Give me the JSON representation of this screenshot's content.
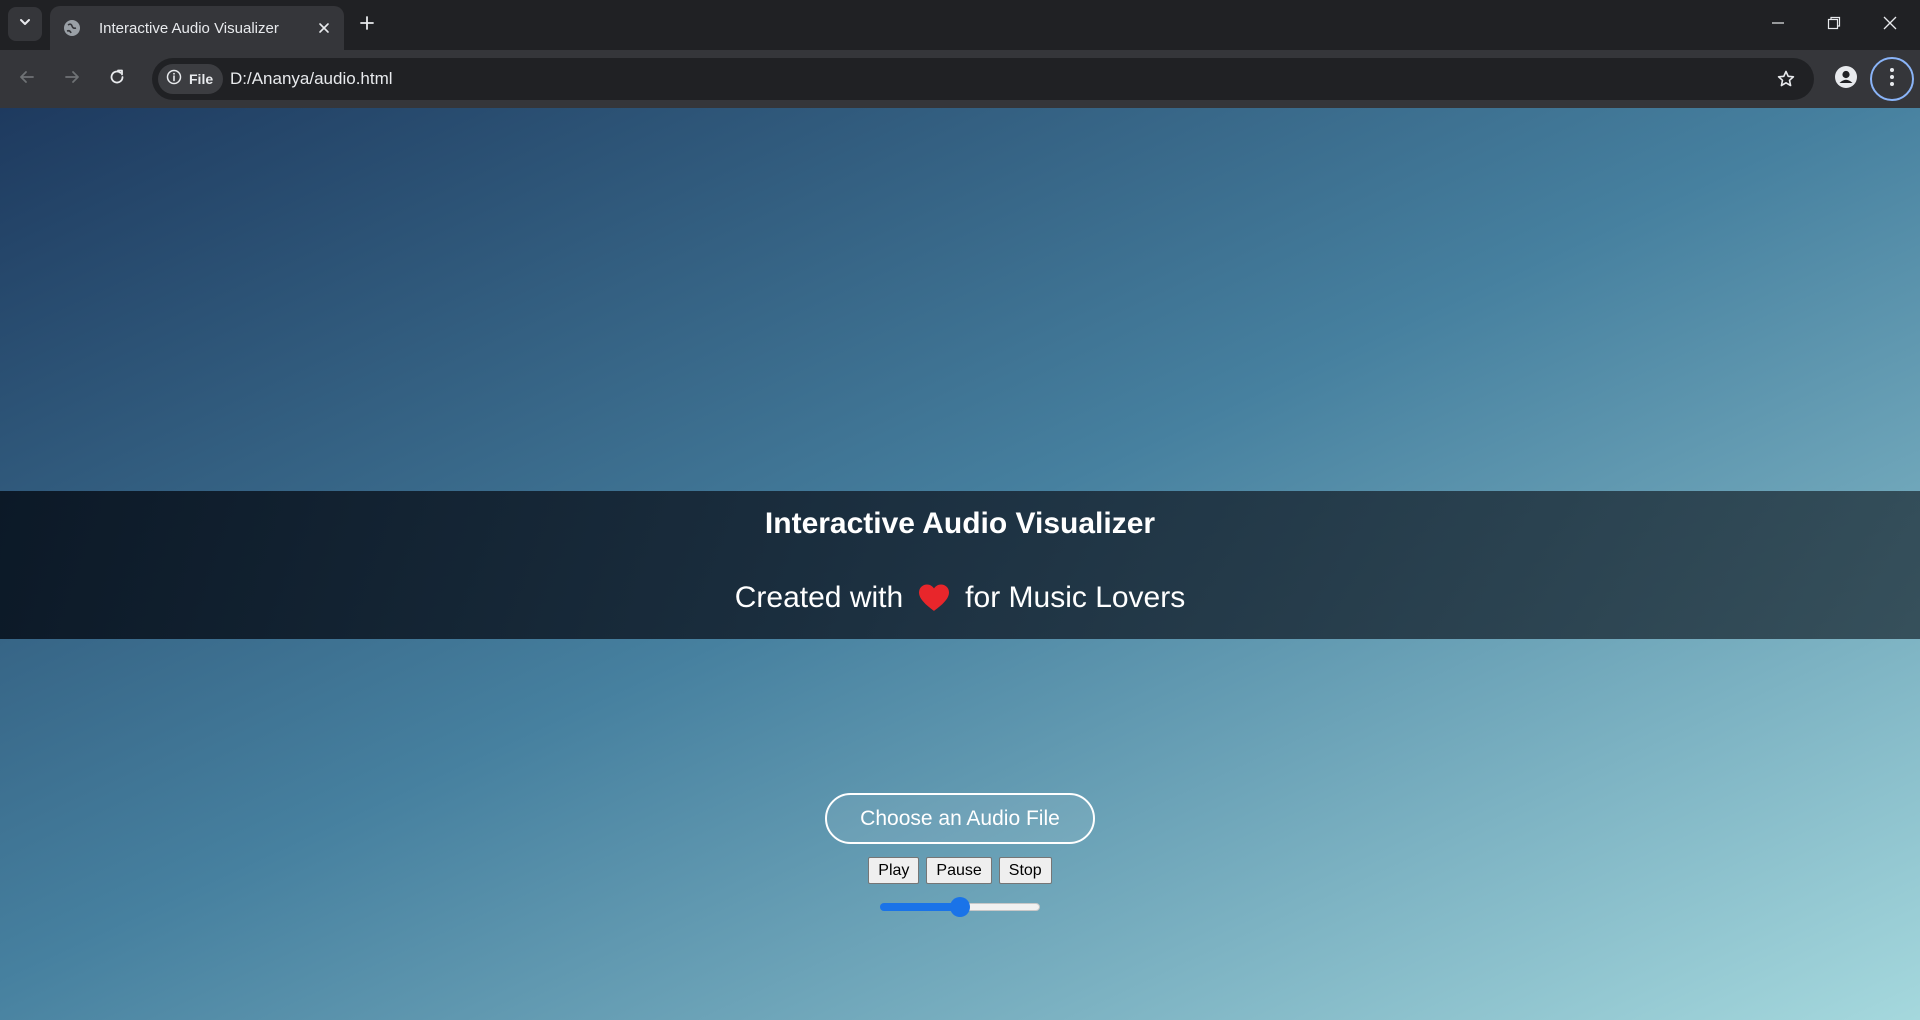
{
  "browser": {
    "tab_title": "Interactive Audio Visualizer",
    "site_chip_label": "File",
    "url": "D:/Ananya/audio.html"
  },
  "page": {
    "banner_title": "Interactive Audio Visualizer",
    "subtitle_before": "Created with",
    "subtitle_after": "for Music Lovers",
    "heart_color": "#e8262b",
    "choose_file_label": "Choose an Audio File",
    "play_label": "Play",
    "pause_label": "Pause",
    "stop_label": "Stop",
    "volume_fraction": 0.5,
    "accent_color": "#1a73e8"
  }
}
